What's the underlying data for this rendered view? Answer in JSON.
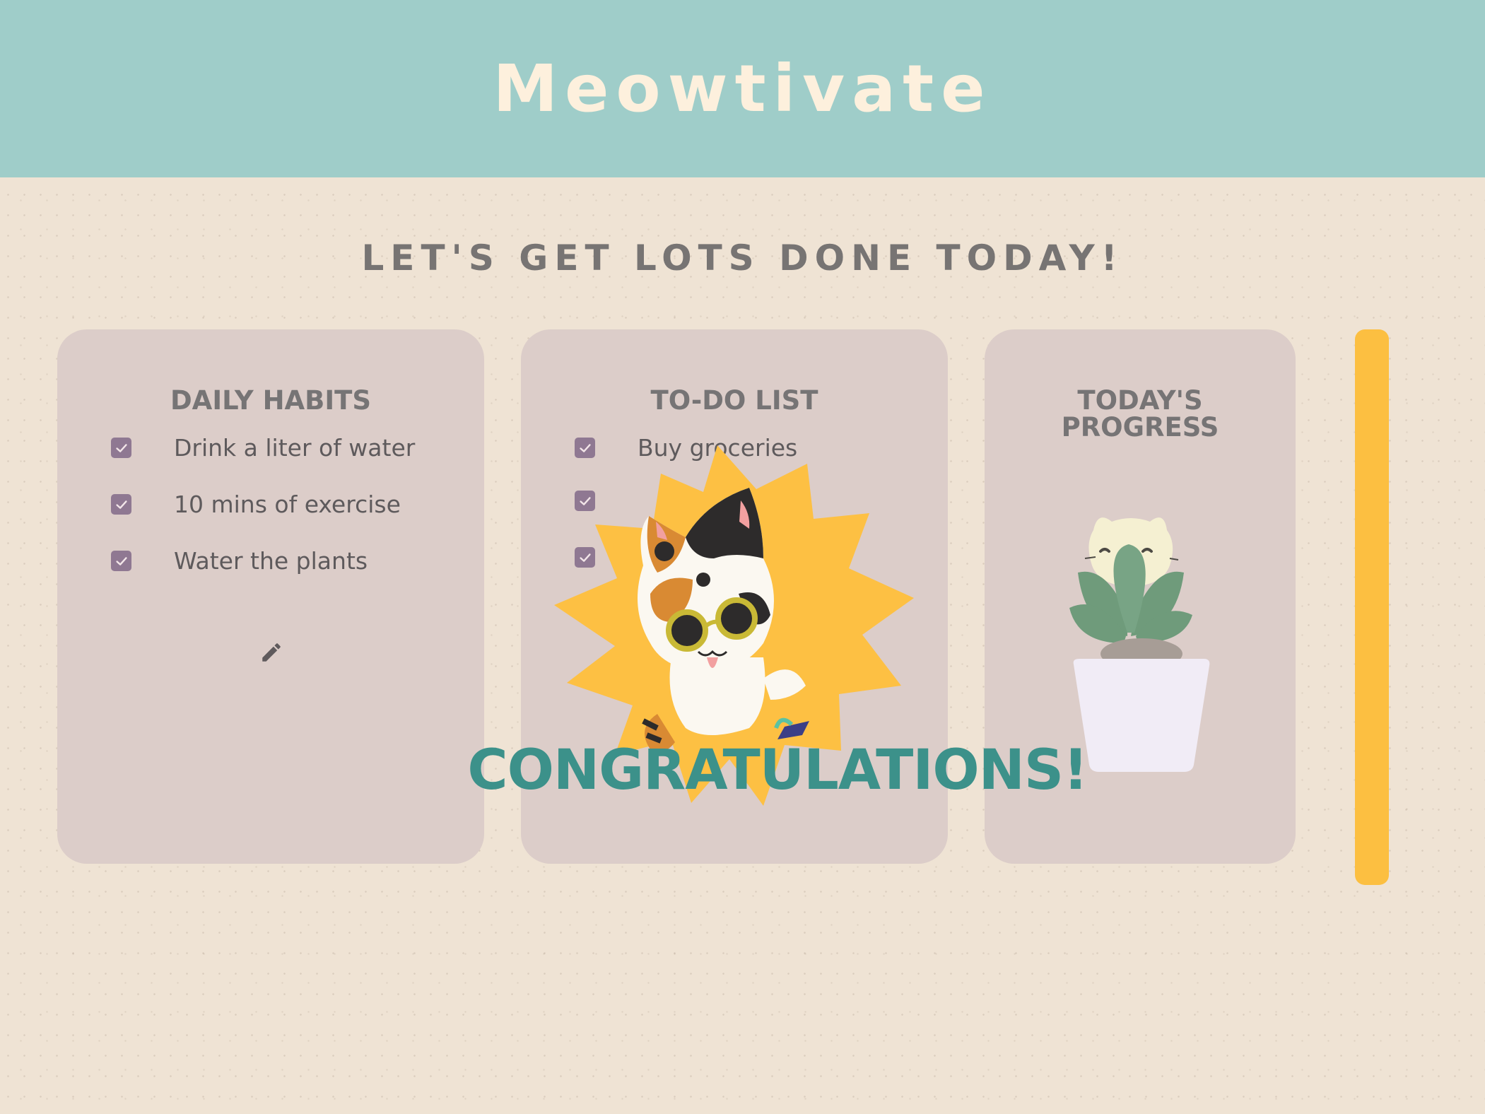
{
  "header": {
    "title": "Meowtivate"
  },
  "tagline": "LET'S GET LOTS DONE TODAY!",
  "habits": {
    "title": "DAILY HABITS",
    "items": [
      {
        "label": "Drink a liter of water",
        "checked": true
      },
      {
        "label": "10 mins of exercise",
        "checked": true
      },
      {
        "label": "Water the plants",
        "checked": true
      }
    ],
    "edit_icon": "pencil-icon"
  },
  "todo": {
    "title": "TO-DO LIST",
    "items": [
      {
        "label": "Buy groceries",
        "checked": true
      },
      {
        "label": "",
        "checked": true
      },
      {
        "label": "",
        "checked": true
      }
    ]
  },
  "progress": {
    "title_line1": "TODAY'S",
    "title_line2": "PROGRESS",
    "plant_icon": "cat-plant-icon",
    "level": 1.0
  },
  "overlay": {
    "message": "CONGRATULATIONS!",
    "icon": "cat-celebration-icon"
  },
  "colors": {
    "header_bg": "#9fcdc9",
    "page_bg": "#efe3d4",
    "card_bg": "#dccdc9",
    "checkbox": "#8f7892",
    "progress_fill": "#fcbf41",
    "congrats": "#3c918a"
  }
}
